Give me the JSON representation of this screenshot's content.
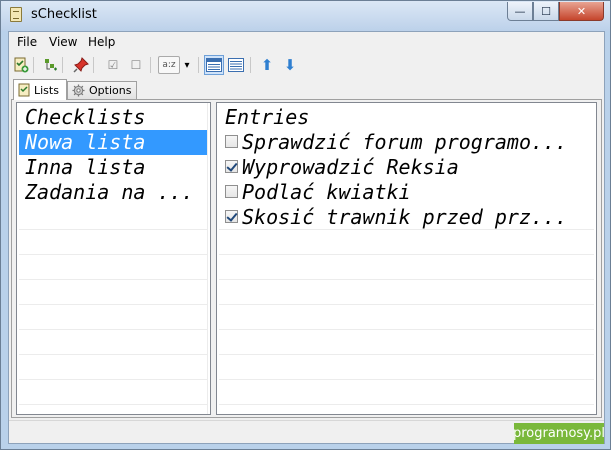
{
  "window": {
    "title": "sChecklist",
    "min_label": "—",
    "max_label": "☐",
    "close_label": "✕"
  },
  "menu": {
    "items": [
      "File",
      "View",
      "Help"
    ]
  },
  "toolbar": {
    "icons": [
      "new-list-icon",
      "add-entry-icon",
      "pin-icon",
      "check-all-icon",
      "uncheck-all-icon",
      "sort-icon",
      "dropdown-arrow-icon",
      "view-details-icon",
      "view-list-icon",
      "move-up-icon",
      "move-down-icon"
    ],
    "glyphs": {
      "check": "☑",
      "uncheck": "☐",
      "sort": "a:z",
      "dropdown": "▾",
      "up": "⬆",
      "down": "⬇"
    }
  },
  "tabs": [
    {
      "label": "Lists",
      "active": true
    },
    {
      "label": "Options",
      "active": false
    }
  ],
  "lists": {
    "header": "Checklists",
    "items": [
      {
        "label": "Nowa lista",
        "selected": true
      },
      {
        "label": "Inna lista",
        "selected": false
      },
      {
        "label": "Zadania na ...",
        "selected": false
      }
    ]
  },
  "entries": {
    "header": "Entries",
    "items": [
      {
        "label": "Sprawdzić forum programo...",
        "checked": false
      },
      {
        "label": "Wyprowadzić Reksia",
        "checked": true
      },
      {
        "label": "Podlać kwiatki",
        "checked": false
      },
      {
        "label": "Skosić trawnik przed prz...",
        "checked": true
      }
    ]
  },
  "watermark": "programosy.pl",
  "colors": {
    "selection": "#3399ff",
    "watermark_bg": "#7ab83b",
    "arrow": "#2f7fd0"
  }
}
